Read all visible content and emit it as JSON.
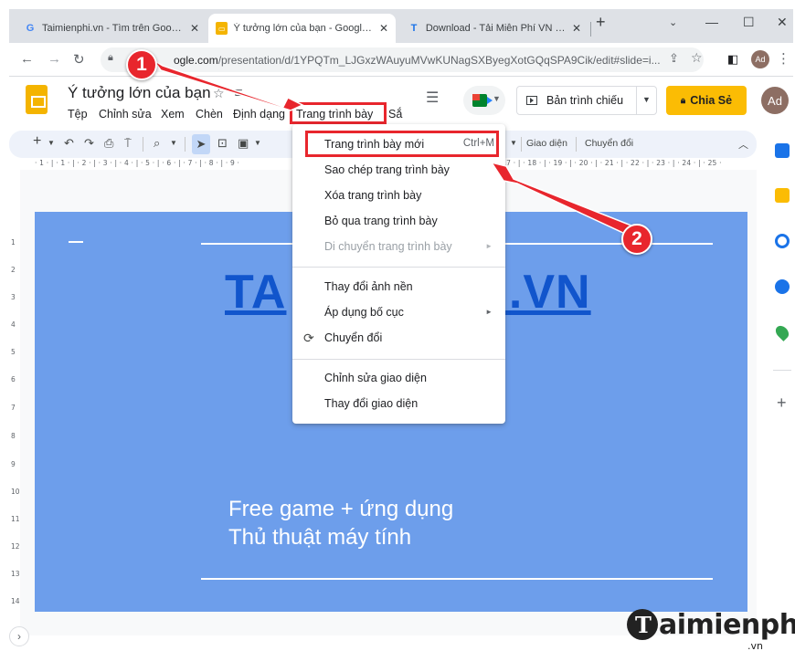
{
  "browser": {
    "tabs": [
      {
        "favicon": "google-g-icon",
        "title": "Taimienphi.vn - Tìm trên Google",
        "active": false
      },
      {
        "favicon": "google-slides-icon",
        "title": "Ý tưởng lớn của bạn - Google Tr",
        "active": true
      },
      {
        "favicon": "taimienphi-t-icon",
        "title": "Download - Tải Miễn Phí VN - P",
        "active": false
      }
    ],
    "new_tab_glyph": "+",
    "url_host": "ogle.com",
    "url_path": "/presentation/d/1YPQTm_LJGxzWAuyuMVwKUNagSXByegXotGQqSPA9Cik/edit#slide=i...",
    "profile_initials": "Ad"
  },
  "app": {
    "doc_title": "Ý tưởng lớn của bạn",
    "menus": [
      "Tệp",
      "Chỉnh sửa",
      "Xem",
      "Chèn",
      "Định dạng",
      "Trang trình bày",
      "Sắ"
    ],
    "present_label": "Bản trình chiếu",
    "share_label": "Chia Sẻ",
    "user_initials": "Ad"
  },
  "toolbar": {
    "theme_label": "Giao diện",
    "transition_label": "Chuyển đổi"
  },
  "ruler": {
    "horizontal": "· 1 · | · 1 · | · 2 · | · 3 · | · 4 · | · 5 · | · 6 · | · 7 · | · 8 · | · 9 ·",
    "horizontal_right": "· 17 · | · 18 · | · 19 · | · 20 · | · 21 · | · 22 · | · 23 · | · 24 · | · 25 ·",
    "vertical": [
      "1",
      "2",
      "3",
      "4",
      "5",
      "6",
      "7",
      "8",
      "9",
      "10",
      "11",
      "12",
      "13",
      "14"
    ]
  },
  "slide": {
    "title_left": "TA",
    "title_right": "I.VN",
    "line1": "Free game + ứng dụng",
    "line2": "Thủ thuật máy tính",
    "background": "#6d9eeb",
    "title_color": "#1155cc"
  },
  "dropdown": {
    "items": [
      {
        "label": "Trang trình bày mới",
        "shortcut": "Ctrl+M"
      },
      {
        "label": "Sao chép trang trình bày"
      },
      {
        "label": "Xóa trang trình bày"
      },
      {
        "label": "Bỏ qua trang trình bày"
      },
      {
        "label": "Di chuyển trang trình bày",
        "disabled": true
      },
      {
        "label": "Thay đổi ảnh nền"
      },
      {
        "label": "Áp dụng bố cục"
      },
      {
        "label": "Chuyển đổi",
        "icon": "transition-icon"
      },
      {
        "label": "Chỉnh sửa giao diện"
      },
      {
        "label": "Thay đổi giao diện"
      }
    ]
  },
  "annotations": {
    "step1": "1",
    "step2": "2",
    "color": "#e8262d"
  },
  "watermark": {
    "brand": "aimienphi",
    "sub": ".vn"
  }
}
